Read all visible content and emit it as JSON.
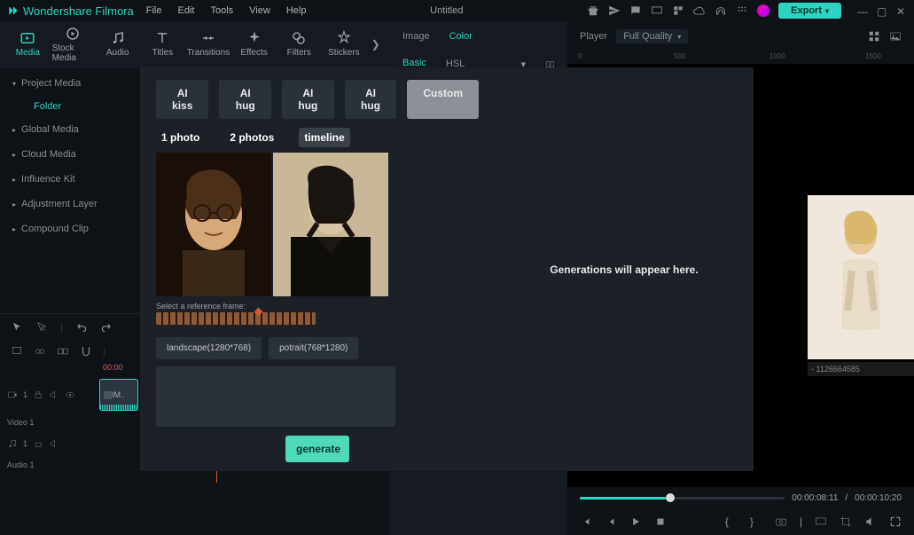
{
  "app_name": "Wondershare Filmora",
  "menu": {
    "file": "File",
    "edit": "Edit",
    "tools": "Tools",
    "view": "View",
    "help": "Help"
  },
  "doc_title": "Untitled",
  "export_label": "Export",
  "tabs": {
    "media": "Media",
    "stock": "Stock Media",
    "audio": "Audio",
    "titles": "Titles",
    "transitions": "Transitions",
    "effects": "Effects",
    "filters": "Filters",
    "stickers": "Stickers"
  },
  "sidebar": {
    "project": "Project Media",
    "folder": "Folder",
    "global": "Global Media",
    "cloud": "Cloud Media",
    "influence": "Influence Kit",
    "adjust": "Adjustment Layer",
    "compound": "Compound Clip"
  },
  "inspector": {
    "image": "Image",
    "color": "Color",
    "basic": "Basic",
    "hsl": "HSL"
  },
  "player": {
    "label": "Player",
    "quality": "Full Quality"
  },
  "ruler_ticks": [
    "0",
    "500",
    "1000",
    "1500"
  ],
  "preview_caption": "- 1126664585",
  "time": {
    "current": "00:00:08:11",
    "sep": "/",
    "total": "00:00:10:20"
  },
  "timeline": {
    "t0": "00:00",
    "clip1": "IM..",
    "video_label": "Video 1",
    "audio_label": "Audio 1"
  },
  "modal": {
    "presets": [
      "AI kiss",
      "AI hug",
      "AI hug",
      "AI hug",
      "Custom"
    ],
    "modes": {
      "one": "1 photo",
      "two": "2 photos",
      "timeline": "timeline"
    },
    "ref_label": "Select a reference frame:",
    "dims": {
      "landscape": "landscape(1280*768)",
      "portrait": "potrait(768*1280)"
    },
    "generate": "generate",
    "placeholder": "Generations will appear here."
  }
}
